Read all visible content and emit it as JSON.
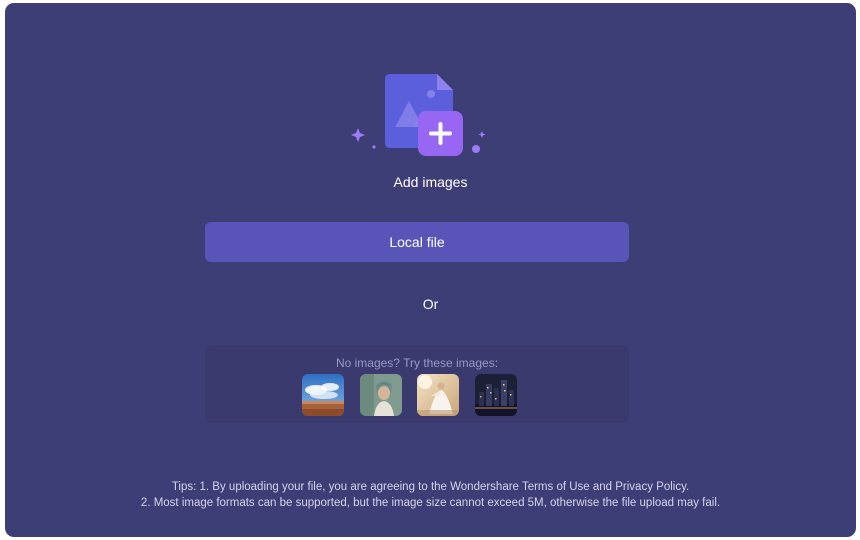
{
  "upload": {
    "title": "Add images",
    "local_file_label": "Local file",
    "or_label": "Or",
    "illustration_icon": "image-file-plus-icon"
  },
  "samples": {
    "label": "No images?  Try these images:",
    "images": [
      {
        "name": "sky-field-thumbnail"
      },
      {
        "name": "woman-portrait-thumbnail"
      },
      {
        "name": "white-dress-thumbnail"
      },
      {
        "name": "city-night-thumbnail"
      }
    ]
  },
  "tips": {
    "line1": "Tips: 1. By uploading your file, you are agreeing to the Wondershare Terms of Use and Privacy Policy.",
    "line2": "2. Most image formats can be supported, but the image size cannot exceed 5M, otherwise the file upload may fail."
  },
  "colors": {
    "background": "#3e3e77",
    "button": "#5955b8",
    "accent": "#8b6cf2"
  }
}
